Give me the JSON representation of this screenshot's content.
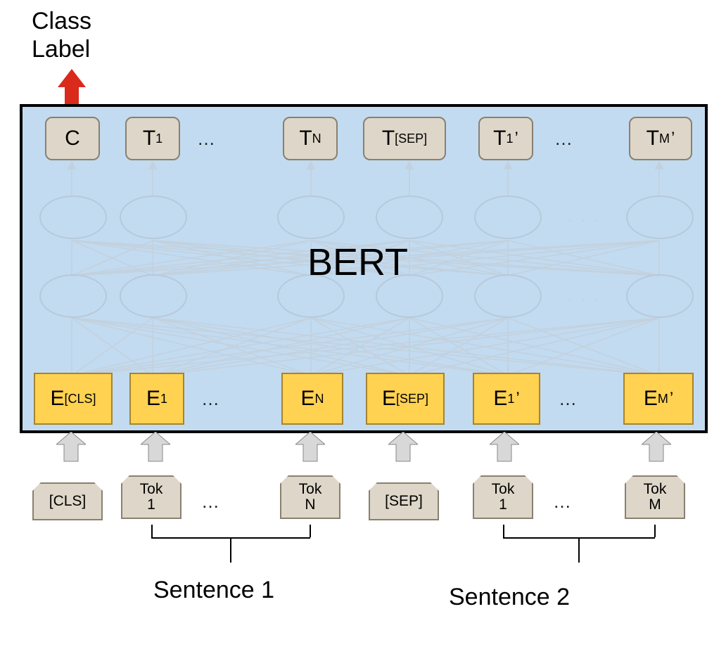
{
  "class_label_line1": "Class",
  "class_label_line2": "Label",
  "model_name": "BERT",
  "outputs": {
    "c": "C",
    "t1_base": "T",
    "t1_sub": "1",
    "tn_base": "T",
    "tn_sub": "N",
    "tsep_base": "T",
    "tsep_sub": "[SEP]",
    "t1p_base": "T",
    "t1p_sub": "1",
    "tmp_base": "T",
    "tmp_sub": "M"
  },
  "embeddings": {
    "ecls_base": "E",
    "ecls_sub": "[CLS]",
    "e1_base": "E",
    "e1_sub": "1",
    "en_base": "E",
    "en_sub": "N",
    "esep_base": "E",
    "esep_sub": "[SEP]",
    "e1p_base": "E",
    "e1p_sub": "1",
    "emp_base": "E",
    "emp_sub": "M"
  },
  "tokens": {
    "cls": "[CLS]",
    "tok1_l1": "Tok",
    "tok1_l2": "1",
    "tokn_l1": "Tok",
    "tokn_l2": "N",
    "sep": "[SEP]",
    "tok1b_l1": "Tok",
    "tok1b_l2": "1",
    "tokm_l1": "Tok",
    "tokm_l2": "M"
  },
  "dots": "…",
  "faded_dots": ". . .",
  "sentence1": "Sentence 1",
  "sentence2": "Sentence 2",
  "prime": "’"
}
